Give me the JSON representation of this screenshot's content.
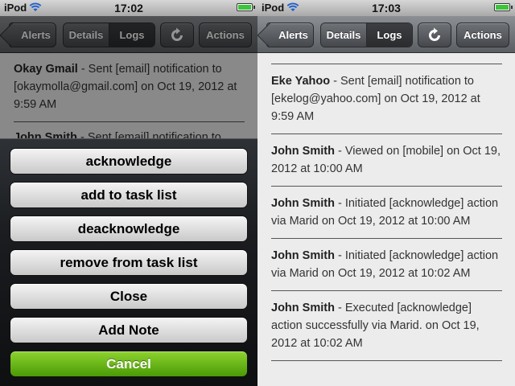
{
  "left": {
    "status": {
      "carrier": "iPod",
      "time": "17:02"
    },
    "nav": {
      "back": "Alerts",
      "seg_details": "Details",
      "seg_logs": "Logs",
      "actions": "Actions"
    },
    "logs": [
      {
        "name": "Okay Gmail",
        "text": " - Sent [email] notification to [okaymolla@gmail.com] on Oct 19, 2012 at 9:59 AM"
      },
      {
        "name": "John Smith",
        "text": " - Sent [email] notification to"
      }
    ],
    "sheet": {
      "buttons": [
        "acknowledge",
        "add to task list",
        "deacknowledge",
        "remove from task list",
        "Close",
        "Add Note"
      ],
      "cancel": "Cancel"
    }
  },
  "right": {
    "status": {
      "carrier": "iPod",
      "time": "17:03"
    },
    "nav": {
      "back": "Alerts",
      "seg_details": "Details",
      "seg_logs": "Logs",
      "actions": "Actions"
    },
    "logs": [
      {
        "name": "Eke Yahoo",
        "text": " - Sent [email] notification to [ekelog@yahoo.com] on Oct 19, 2012 at 9:59 AM"
      },
      {
        "name": "John Smith",
        "text": " - Viewed on [mobile] on Oct 19, 2012 at 10:00 AM"
      },
      {
        "name": "John Smith",
        "text": " - Initiated [acknowledge] action via Marid on Oct 19, 2012 at 10:00 AM"
      },
      {
        "name": "John Smith",
        "text": " - Initiated [acknowledge] action via Marid on Oct 19, 2012 at 10:02 AM"
      },
      {
        "name": "John Smith",
        "text": " - Executed [acknowledge] action successfully via Marid. on Oct 19, 2012 at 10:02 AM"
      }
    ]
  },
  "colors": {
    "cancel_green": "#6ab81a",
    "nav_bar": "#6f7276",
    "battery": "#3cc43c"
  },
  "icons": {
    "wifi": "wifi-icon",
    "battery": "battery-icon",
    "refresh": "refresh-icon"
  }
}
